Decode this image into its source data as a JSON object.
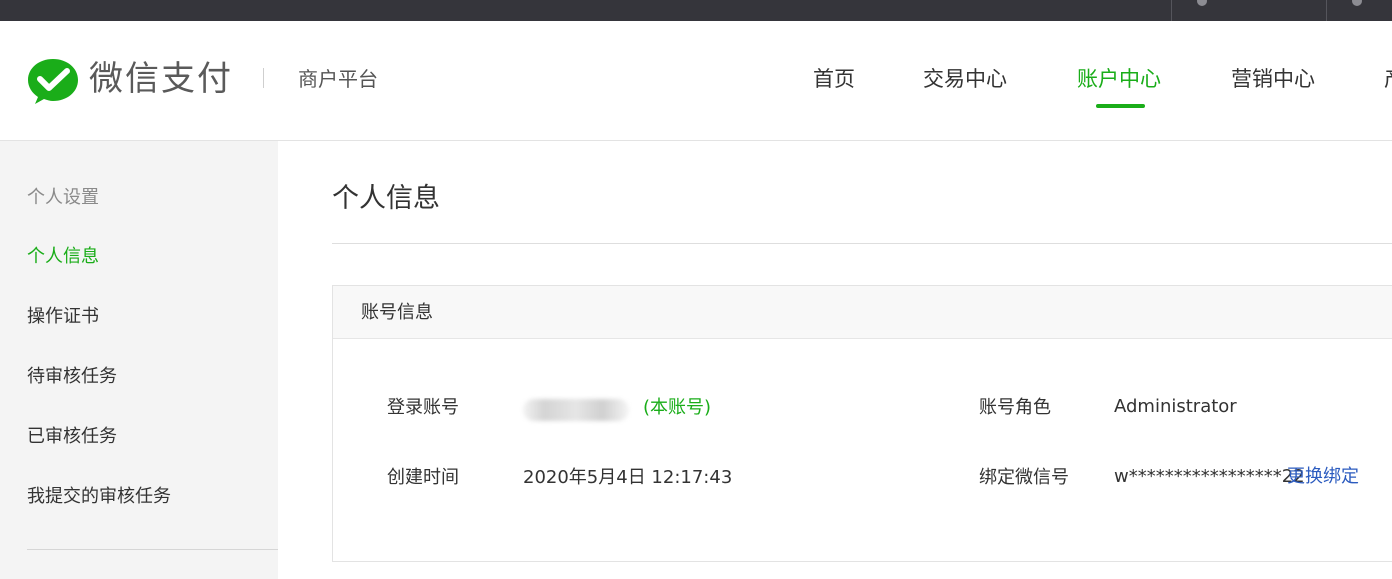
{
  "header": {
    "brand": "微信支付",
    "platform": "商户平台",
    "nav": [
      {
        "label": "首页"
      },
      {
        "label": "交易中心"
      },
      {
        "label": "账户中心"
      },
      {
        "label": "营销中心"
      },
      {
        "label": "产"
      }
    ],
    "active_nav": "账户中心"
  },
  "sidebar": {
    "group_title": "个人设置",
    "items": [
      {
        "label": "个人信息"
      },
      {
        "label": "操作证书"
      },
      {
        "label": "待审核任务"
      },
      {
        "label": "已审核任务"
      },
      {
        "label": "我提交的审核任务"
      }
    ],
    "active_item": "个人信息"
  },
  "main": {
    "page_title": "个人信息",
    "card": {
      "title": "账号信息",
      "login_account_label": "登录账号",
      "login_account_note": "(本账号)",
      "created_label": "创建时间",
      "created_value": "2020年5月4日 12:17:43",
      "role_label": "账号角色",
      "role_value": "Administrator",
      "wechat_label": "绑定微信号",
      "wechat_value": "w*****************22",
      "change_bind_label": "更换绑定"
    }
  },
  "colors": {
    "accent": "#1aad19",
    "link": "#2b5bbf",
    "topbar": "#35353b",
    "sidebar_bg": "#f4f4f4"
  },
  "icons": {
    "logo": "wechat-pay-logo-icon"
  }
}
